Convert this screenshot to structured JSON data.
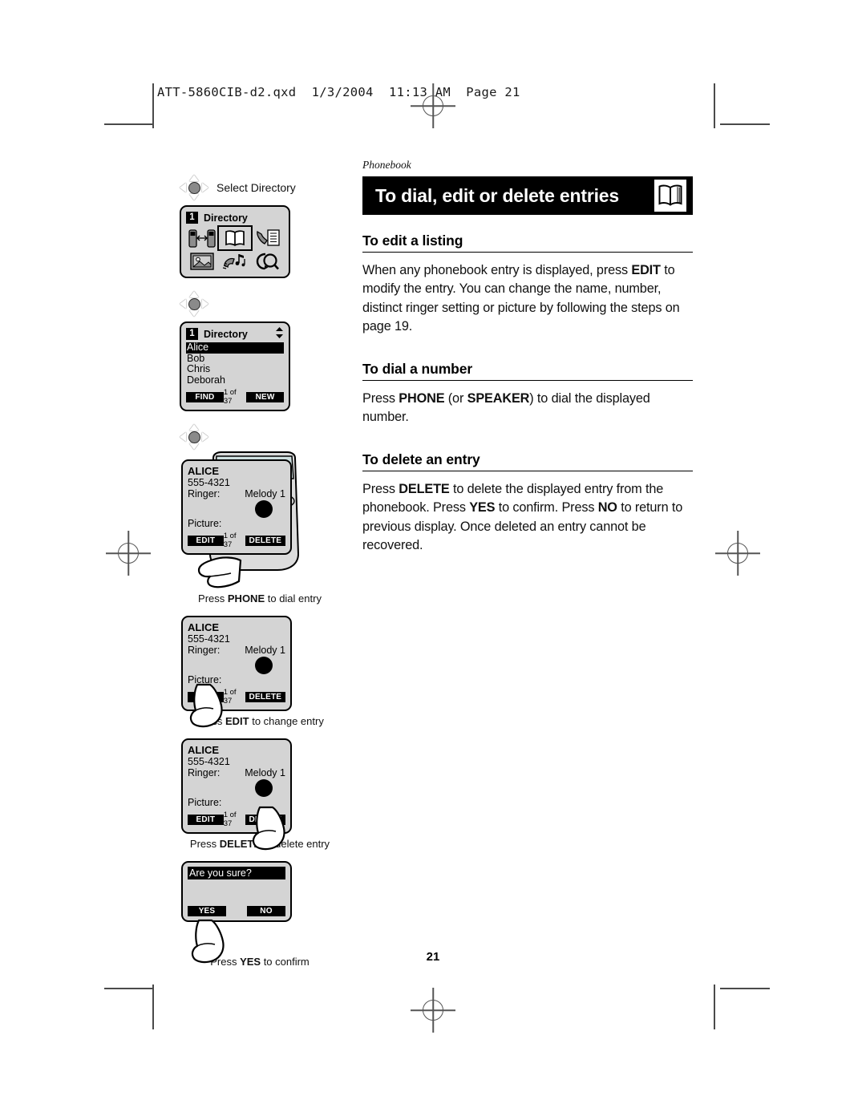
{
  "print_slug": "ATT-5860CIB-d2.qxd  1/3/2004  11:13 AM  Page 21",
  "page_number": "21",
  "content": {
    "kicker": "Phonebook",
    "title": "To dial, edit or delete entries",
    "title_icon": "open-book-icon",
    "sections": [
      {
        "heading": "To edit a listing",
        "paragraph_parts": [
          {
            "t": "When any phonebook entry is displayed, press ",
            "b": false
          },
          {
            "t": "EDIT",
            "b": true
          },
          {
            "t": " to modify the entry. You can change the name, number, distinct ringer setting or picture by following the steps on page 19.",
            "b": false
          }
        ]
      },
      {
        "heading": "To dial a number",
        "paragraph_parts": [
          {
            "t": "Press ",
            "b": false
          },
          {
            "t": "PHONE",
            "b": true
          },
          {
            "t": " (or ",
            "b": false
          },
          {
            "t": "SPEAKER",
            "b": true
          },
          {
            "t": ") to dial the displayed number.",
            "b": false
          }
        ]
      },
      {
        "heading": "To delete an entry",
        "paragraph_parts": [
          {
            "t": "Press ",
            "b": false
          },
          {
            "t": "DELETE",
            "b": true
          },
          {
            "t": " to delete the displayed entry from the phonebook. Press ",
            "b": false
          },
          {
            "t": "YES",
            "b": true
          },
          {
            "t": " to confirm. Press ",
            "b": false
          },
          {
            "t": "NO",
            "b": true
          },
          {
            "t": " to return to previous display. Once deleted an entry cannot be recovered.",
            "b": false
          }
        ]
      }
    ]
  },
  "illustrations": {
    "nav_label_top": "Select Directory",
    "menu_screen": {
      "index": "1",
      "title": "Directory",
      "icons": [
        "intercom-handsets-icon",
        "directory-book-icon",
        "call-log-icon",
        "picture-frame-icon",
        "ringer-melody-icon",
        "caller-id-search-icon"
      ],
      "selected_icon": "directory-book-icon"
    },
    "list_screen": {
      "index": "1",
      "title": "Directory",
      "scroll_indicator": "up-down-arrows-icon",
      "entries": [
        "Alice",
        "Bob",
        "Chris",
        "Deborah"
      ],
      "highlighted_entry": "Alice",
      "softkey_left": "FIND",
      "counter": "1 of 37",
      "softkey_right": "NEW"
    },
    "entry_screen": {
      "name": "ALICE",
      "number": "555-4321",
      "ringer_label": "Ringer:",
      "ringer_value": "Melody 1",
      "picture_label": "Picture:",
      "softkey_left": "EDIT",
      "counter": "1 of 37",
      "softkey_right": "DELETE"
    },
    "confirm_screen": {
      "prompt": "Are you sure?",
      "softkey_left": "YES",
      "softkey_right": "NO"
    },
    "captions": [
      {
        "parts": [
          {
            "t": "Press ",
            "b": false
          },
          {
            "t": "PHONE",
            "b": true
          },
          {
            "t": " to dial entry",
            "b": false
          }
        ]
      },
      {
        "parts": [
          {
            "t": "Press ",
            "b": false
          },
          {
            "t": "EDIT",
            "b": true
          },
          {
            "t": " to change entry",
            "b": false
          }
        ]
      },
      {
        "parts": [
          {
            "t": "Press ",
            "b": false
          },
          {
            "t": "DELETE",
            "b": true
          },
          {
            "t": " to delete entry",
            "b": false
          }
        ]
      },
      {
        "parts": [
          {
            "t": "Press ",
            "b": false
          },
          {
            "t": "YES",
            "b": true
          },
          {
            "t": " to confirm",
            "b": false
          }
        ]
      }
    ]
  },
  "colors": {
    "title_bar_bg": "#000000",
    "title_bar_text": "#ffffff",
    "lcd_bg": "#d4d4d4",
    "paper": "#ffffff",
    "ink": "#111111"
  }
}
